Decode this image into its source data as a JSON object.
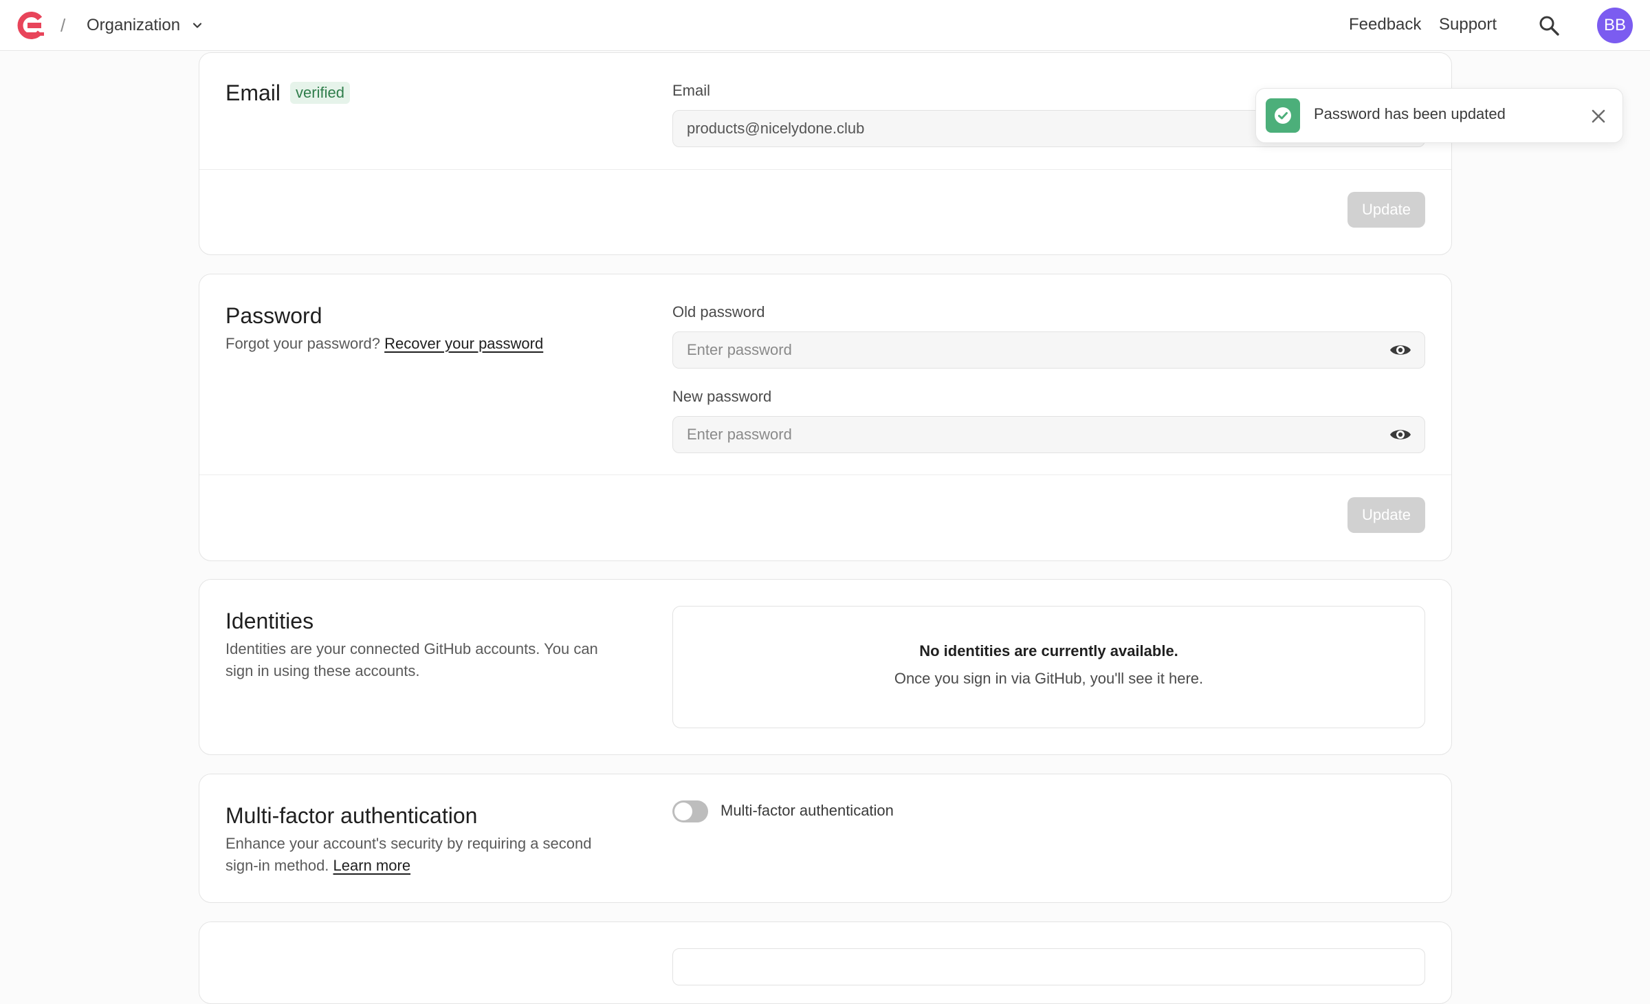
{
  "header": {
    "separator": "/",
    "org_label": "Organization",
    "nav": {
      "feedback": "Feedback",
      "support": "Support"
    },
    "avatar_initials": "BB",
    "brand_color": "#e8445a"
  },
  "email_section": {
    "title": "Email",
    "badge": "verified",
    "field_label": "Email",
    "value": "products@nicelydone.club",
    "update_label": "Update"
  },
  "password_section": {
    "title": "Password",
    "forgot_text": "Forgot your password?",
    "recover_link": "Recover your password",
    "old_label": "Old password",
    "old_placeholder": "Enter password",
    "new_label": "New password",
    "new_placeholder": "Enter password",
    "update_label": "Update"
  },
  "identities_section": {
    "title": "Identities",
    "description": "Identities are your connected GitHub accounts. You can sign in using these accounts.",
    "empty_title": "No identities are currently available.",
    "empty_subtitle": "Once you sign in via GitHub, you'll see it here."
  },
  "mfa_section": {
    "title": "Multi-factor authentication",
    "description": "Enhance your account's security by requiring a second sign-in method.",
    "learn_more": "Learn more",
    "toggle_label": "Multi-factor authentication",
    "enabled": false
  },
  "toast": {
    "message": "Password has been updated",
    "status_color": "#4caf7a"
  }
}
